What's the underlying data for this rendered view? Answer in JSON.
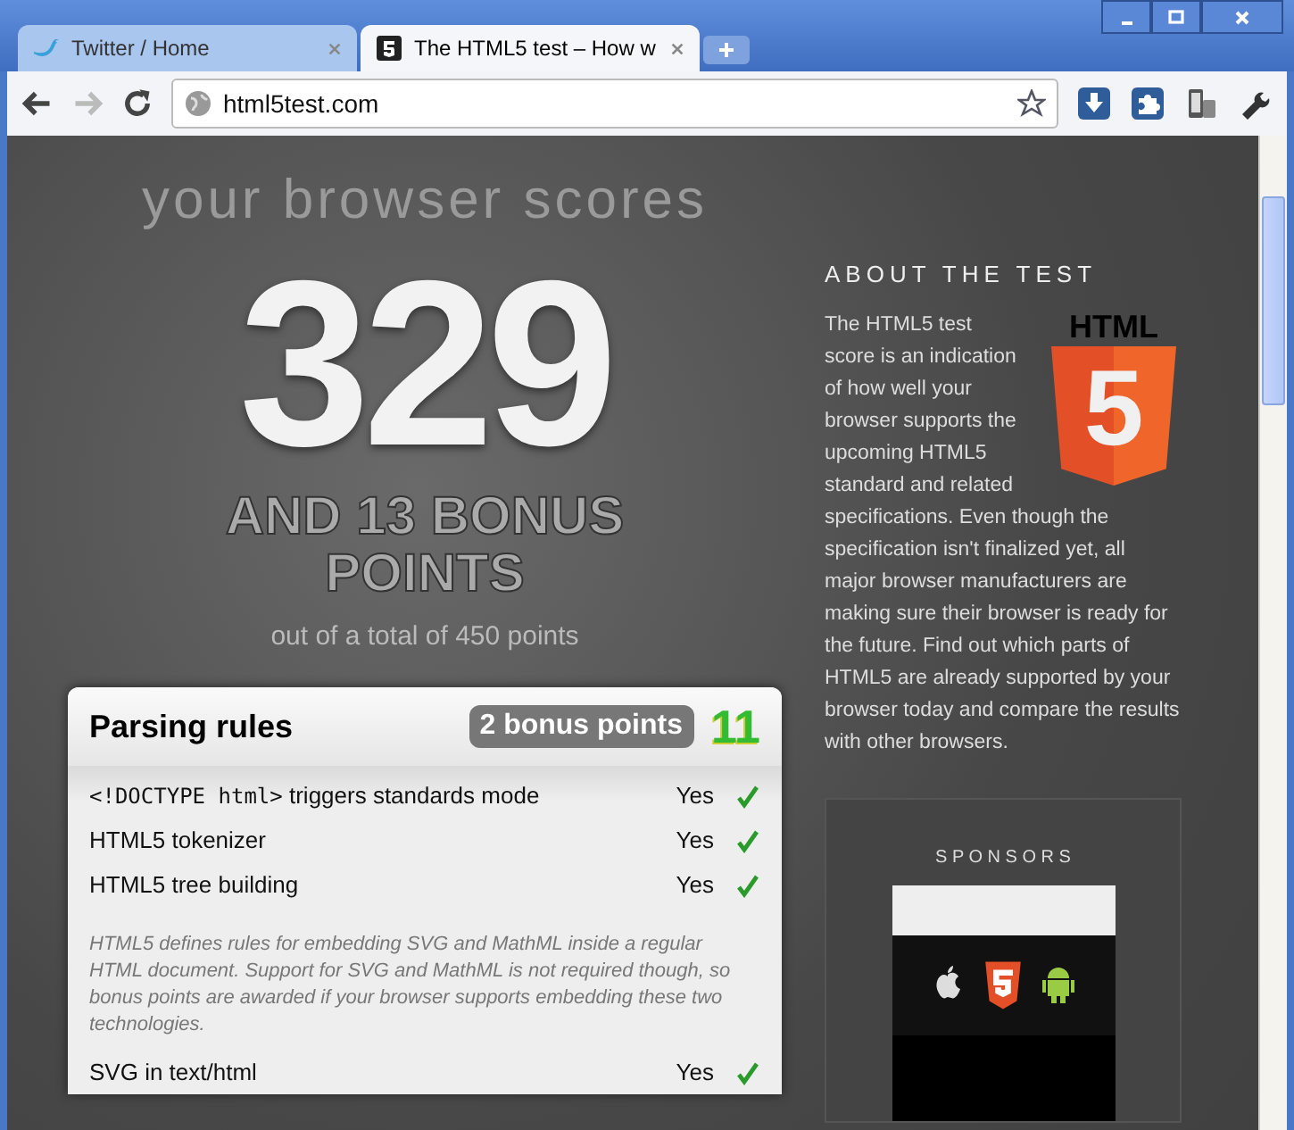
{
  "tabs": [
    {
      "title": "Twitter / Home",
      "selected": false
    },
    {
      "title": "The HTML5 test – How w",
      "selected": true
    }
  ],
  "address_bar": {
    "url": "html5test.com"
  },
  "score": {
    "heading": "your browser scores",
    "points": "329",
    "bonus": "AND 13 BONUS POINTS",
    "total": "out of a total of 450 points"
  },
  "section": {
    "title": "Parsing rules",
    "badge": "2 bonus points",
    "score": "11",
    "rows": [
      {
        "code": "<!DOCTYPE html>",
        "label": "triggers standards mode",
        "result": "Yes",
        "passed": true
      },
      {
        "label": "HTML5 tokenizer",
        "result": "Yes",
        "passed": true
      },
      {
        "label": "HTML5 tree building",
        "result": "Yes",
        "passed": true
      }
    ],
    "note": "HTML5 defines rules for embedding SVG and MathML inside a regular HTML document. Support for SVG and MathML is not required though, so bonus points are awarded if your browser supports embedding these two technologies.",
    "more_rows": [
      {
        "label": "SVG in text/html",
        "result": "Yes",
        "passed": true
      }
    ]
  },
  "about": {
    "heading": "ABOUT THE TEST",
    "logo_text": "HTML",
    "logo_number": "5",
    "text": [
      "The HTML5 test score is an indication of how well your browser supports the upcoming HTML5 standard and related",
      "specifications. Even though the specification isn't finalized yet, all major browser manufacturers are making sure their browser is ready for the future. Find out which parts of HTML5 are already supported by your browser today and compare the results with other browsers."
    ]
  },
  "sponsors": {
    "heading": "S P O N S O R S"
  }
}
